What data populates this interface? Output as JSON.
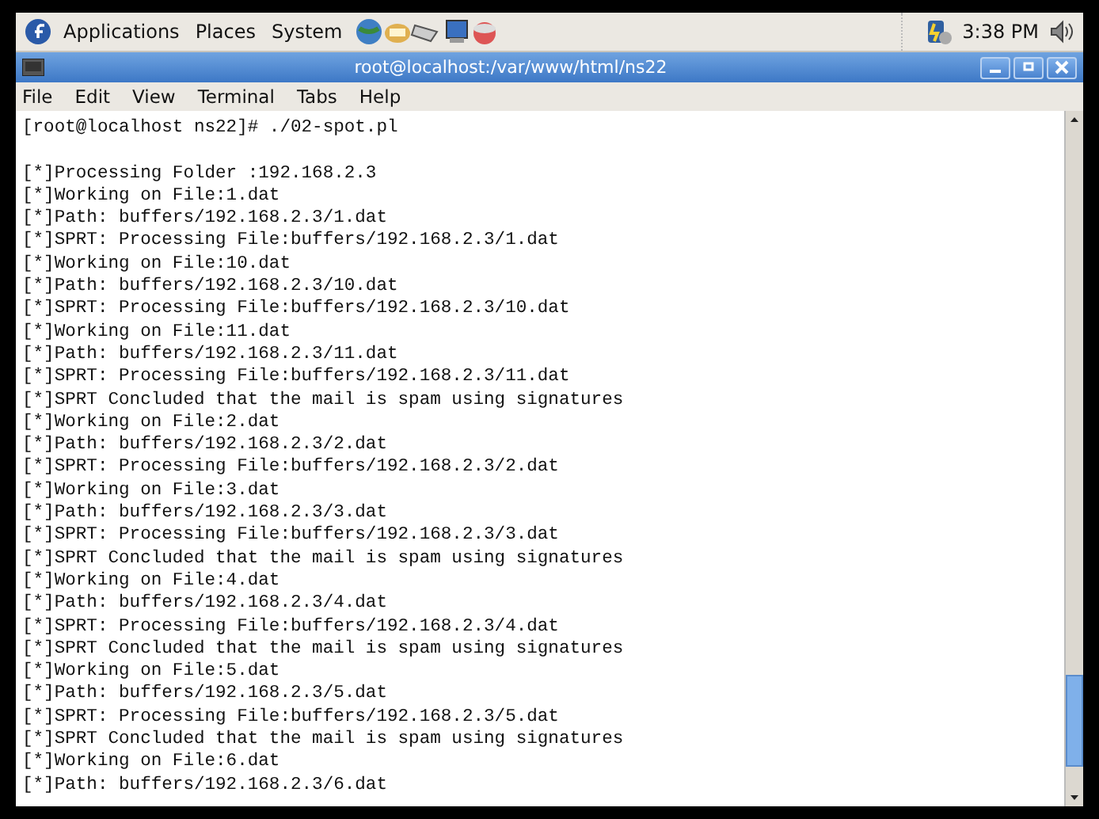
{
  "panel": {
    "menus": [
      "Applications",
      "Places",
      "System"
    ],
    "clock": "3:38 PM"
  },
  "window": {
    "title": "root@localhost:/var/www/html/ns22"
  },
  "menu": [
    "File",
    "Edit",
    "View",
    "Terminal",
    "Tabs",
    "Help"
  ],
  "prompt": "[root@localhost ns22]# ./02-spot.pl",
  "terminal_lines": [
    "[*]Processing Folder :192.168.2.3",
    "[*]Working on File:1.dat",
    "[*]Path: buffers/192.168.2.3/1.dat",
    "[*]SPRT: Processing File:buffers/192.168.2.3/1.dat",
    "[*]Working on File:10.dat",
    "[*]Path: buffers/192.168.2.3/10.dat",
    "[*]SPRT: Processing File:buffers/192.168.2.3/10.dat",
    "[*]Working on File:11.dat",
    "[*]Path: buffers/192.168.2.3/11.dat",
    "[*]SPRT: Processing File:buffers/192.168.2.3/11.dat",
    "[*]SPRT Concluded that the mail is spam using signatures",
    "[*]Working on File:2.dat",
    "[*]Path: buffers/192.168.2.3/2.dat",
    "[*]SPRT: Processing File:buffers/192.168.2.3/2.dat",
    "[*]Working on File:3.dat",
    "[*]Path: buffers/192.168.2.3/3.dat",
    "[*]SPRT: Processing File:buffers/192.168.2.3/3.dat",
    "[*]SPRT Concluded that the mail is spam using signatures",
    "[*]Working on File:4.dat",
    "[*]Path: buffers/192.168.2.3/4.dat",
    "[*]SPRT: Processing File:buffers/192.168.2.3/4.dat",
    "[*]SPRT Concluded that the mail is spam using signatures",
    "[*]Working on File:5.dat",
    "[*]Path: buffers/192.168.2.3/5.dat",
    "[*]SPRT: Processing File:buffers/192.168.2.3/5.dat",
    "[*]SPRT Concluded that the mail is spam using signatures",
    "[*]Working on File:6.dat",
    "[*]Path: buffers/192.168.2.3/6.dat"
  ]
}
